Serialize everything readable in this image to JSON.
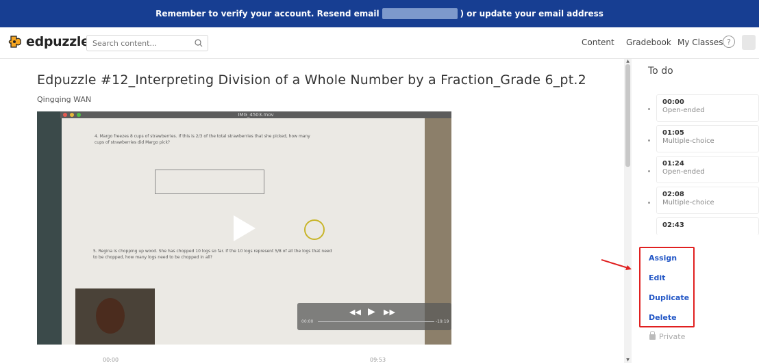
{
  "banner": {
    "text_before": "Remember to verify your account. Resend email",
    "text_after": ") or  update your email address"
  },
  "header": {
    "logo_text": "edpuzzle",
    "search_placeholder": "Search content...",
    "nav": [
      "Content",
      "Gradebook",
      "My Classes"
    ],
    "help_label": "?"
  },
  "video": {
    "title": "Edpuzzle #12_Interpreting Division of a Whole Number by a Fraction_Grade 6_pt.2",
    "author": "Qingqing WAN",
    "file_label": "IMG_4503.mov",
    "question_4": "4.  Margo freezes 8 cups of strawberries. If this is 2/3 of the total strawberries that she picked, how many cups of strawberries did Margo pick?",
    "question_5": "5.  Regina is chopping up wood. She has chopped 10 logs so far. If the 10 logs represent 5/8 of all the logs that need to be chopped, how many logs need to be chopped in all?",
    "below_left_time": "00:00",
    "below_right_time": "09:53",
    "player_time_left": "00:00",
    "player_time_right": "-19:19"
  },
  "sidebar": {
    "todo_title": "To do",
    "items": [
      {
        "time": "00:00",
        "type": "Open-ended"
      },
      {
        "time": "01:05",
        "type": "Multiple-choice"
      },
      {
        "time": "01:24",
        "type": "Open-ended"
      },
      {
        "time": "02:08",
        "type": "Multiple-choice"
      },
      {
        "time": "02:43",
        "type": ""
      }
    ],
    "actions": [
      "Assign",
      "Edit",
      "Duplicate",
      "Delete"
    ],
    "private_label": "Private"
  },
  "colors": {
    "banner": "#173e92",
    "action_link": "#2357c6",
    "highlight_box": "#e02020",
    "logo_orange": "#f6a623"
  }
}
